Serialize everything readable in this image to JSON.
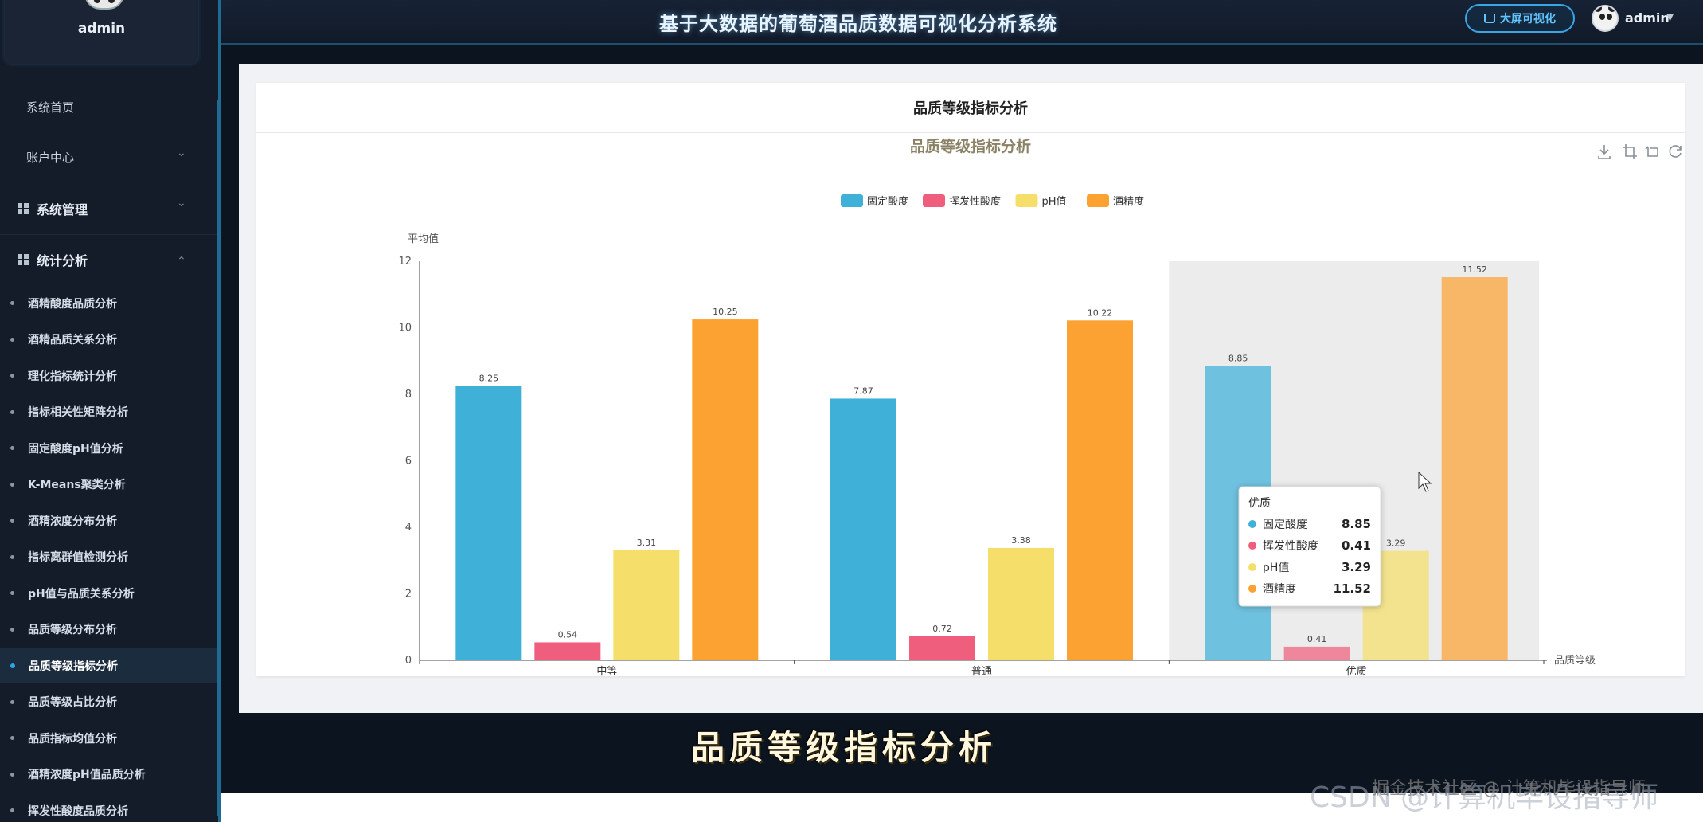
{
  "sidebar": {
    "user_name": "admin",
    "top_items": [
      {
        "label": "系统首页"
      },
      {
        "label": "账户中心"
      }
    ],
    "groups": [
      {
        "label": "系统管理"
      },
      {
        "label": "统计分析"
      }
    ],
    "sub_items": [
      {
        "label": "酒精酸度品质分析"
      },
      {
        "label": "酒精品质关系分析"
      },
      {
        "label": "理化指标统计分析"
      },
      {
        "label": "指标相关性矩阵分析"
      },
      {
        "label": "固定酸度pH值分析"
      },
      {
        "label": "K-Means聚类分析"
      },
      {
        "label": "酒精浓度分布分析"
      },
      {
        "label": "指标离群值检测分析"
      },
      {
        "label": "pH值与品质关系分析"
      },
      {
        "label": "品质等级分布分析"
      },
      {
        "label": "品质等级指标分析"
      },
      {
        "label": "品质等级占比分析"
      },
      {
        "label": "品质指标均值分析"
      },
      {
        "label": "酒精浓度pH值品质分析"
      },
      {
        "label": "挥发性酸度品质分析"
      }
    ],
    "active_index": 10
  },
  "header": {
    "title": "基于大数据的葡萄酒品质数据可视化分析系统",
    "big_screen_label": "大屏可视化",
    "user_name": "admin"
  },
  "card": {
    "title": "品质等级指标分析"
  },
  "chart_data": {
    "type": "bar",
    "title": "品质等级指标分析",
    "ylabel": "平均值",
    "xlabel": "品质等级",
    "ylim": [
      0,
      12
    ],
    "yticks": [
      0,
      2,
      4,
      6,
      8,
      10,
      12
    ],
    "categories": [
      "中等",
      "普通",
      "优质"
    ],
    "series": [
      {
        "name": "固定酸度",
        "color": "#3fb1d9",
        "values": [
          8.25,
          7.87,
          8.85
        ]
      },
      {
        "name": "挥发性酸度",
        "color": "#ef5f7d",
        "values": [
          0.54,
          0.72,
          0.41
        ]
      },
      {
        "name": "pH值",
        "color": "#f5df6a",
        "values": [
          3.31,
          3.38,
          3.29
        ]
      },
      {
        "name": "酒精度",
        "color": "#fba232",
        "values": [
          10.25,
          10.22,
          11.52
        ]
      }
    ],
    "legend_position": "top-center",
    "highlighted_category": "优质",
    "tooltip": {
      "title": "优质",
      "rows": [
        {
          "name": "固定酸度",
          "value": "8.85"
        },
        {
          "name": "挥发性酸度",
          "value": "0.41"
        },
        {
          "name": "pH值",
          "value": "3.29"
        },
        {
          "name": "酒精度",
          "value": "11.52"
        }
      ]
    }
  },
  "caption": "品质等级指标分析",
  "watermark": "CSDN @计算机毕设指导师",
  "watermark_overlay": "掘金技术社区 @ 计算机毕设指导师"
}
